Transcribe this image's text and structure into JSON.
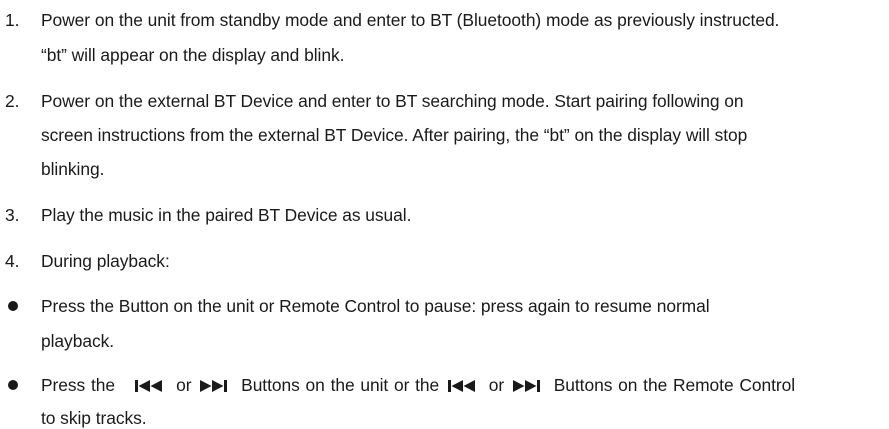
{
  "steps": [
    {
      "number": "1.",
      "lines": [
        "Power on the unit from standby mode and enter to BT (Bluetooth) mode as previously instructed.",
        "“bt” will appear on the display and blink."
      ]
    },
    {
      "number": "2.",
      "lines": [
        "Power on the external BT Device and enter to BT searching mode. Start pairing following on",
        "screen instructions from the external BT Device. After pairing, the “bt” on the display will stop",
        "blinking."
      ]
    },
    {
      "number": "3.",
      "lines": [
        "Play the music in the paired BT Device as usual."
      ]
    },
    {
      "number": "4.",
      "lines": [
        "During playback:"
      ]
    }
  ],
  "bullets": [
    {
      "lines": [
        "Press the Button on the unit or Remote Control to pause: press again to resume normal",
        "playback."
      ]
    },
    {
      "line1": {
        "t1": "Press the",
        "t2": "or",
        "t3": "Buttons on the unit or the",
        "t4": "or",
        "t5": "Buttons on the Remote Control"
      },
      "line2": "to skip tracks."
    }
  ],
  "icons": [
    "skip-previous-icon",
    "skip-next-icon"
  ]
}
